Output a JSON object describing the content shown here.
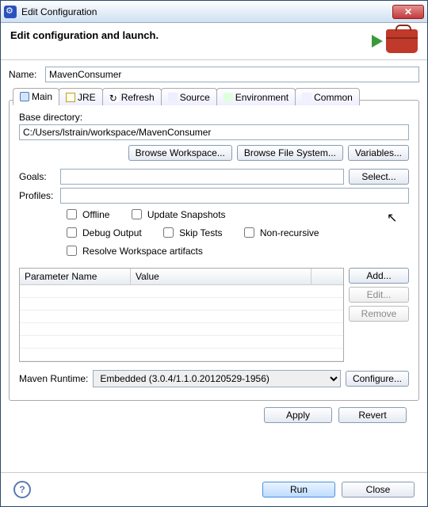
{
  "titlebar": {
    "text": "Edit Configuration",
    "close": "✕"
  },
  "header": {
    "title": "Edit configuration and launch."
  },
  "name": {
    "label": "Name:",
    "value": "MavenConsumer"
  },
  "tabs": {
    "main": "Main",
    "jre": "JRE",
    "refresh": "Refresh",
    "source": "Source",
    "environment": "Environment",
    "common": "Common"
  },
  "main_tab": {
    "basedir_label": "Base directory:",
    "basedir_value": "C:/Users/lstrain/workspace/MavenConsumer",
    "browse_ws": "Browse Workspace...",
    "browse_fs": "Browse File System...",
    "variables": "Variables...",
    "goals_label": "Goals:",
    "goals_value": "",
    "select": "Select...",
    "profiles_label": "Profiles:",
    "profiles_value": "",
    "offline": "Offline",
    "update_snapshots": "Update Snapshots",
    "debug_output": "Debug Output",
    "skip_tests": "Skip Tests",
    "non_recursive": "Non-recursive",
    "resolve_ws": "Resolve Workspace artifacts",
    "param_name": "Parameter Name",
    "param_value": "Value",
    "add": "Add...",
    "edit": "Edit...",
    "remove": "Remove",
    "runtime_label": "Maven Runtime:",
    "runtime_value": "Embedded (3.0.4/1.1.0.20120529-1956)",
    "configure": "Configure..."
  },
  "footer": {
    "apply": "Apply",
    "revert": "Revert",
    "run": "Run",
    "close": "Close",
    "help": "?"
  }
}
